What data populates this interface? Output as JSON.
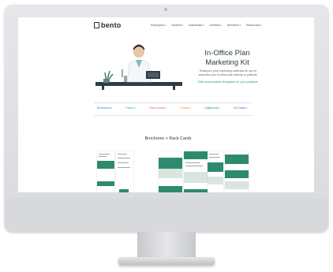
{
  "site": {
    "logo": "bento",
    "nav": [
      "Employers",
      "Brokers",
      "Individuals",
      "Dentists",
      "Members",
      "Resources"
    ]
  },
  "hero": {
    "title_line1": "In-Office Plan",
    "title_line2": "Marketing Kit",
    "subtitle_line1": "Ready-for-print marketing materials for you to",
    "subtitle_line2": "advertise your in-office plan directly to patients.",
    "link": "Edit customizable templates for your practice!"
  },
  "tabs": [
    {
      "label": "Brochures",
      "color": "#2d7fd3"
    },
    {
      "label": "Flyers",
      "color": "#2eb06f"
    },
    {
      "label": "Rack Cards",
      "color": "#e0566f"
    },
    {
      "label": "Emails",
      "color": "#f09030"
    },
    {
      "label": "Digital Ads",
      "color": "#1f9a7a"
    },
    {
      "label": "ID Cards",
      "color": "#2d6fd3"
    }
  ],
  "section": {
    "title": "Brochures + Rack Cards"
  },
  "colors": {
    "accent": "#1d9a78",
    "thumb_green": "#2e8a6e"
  }
}
